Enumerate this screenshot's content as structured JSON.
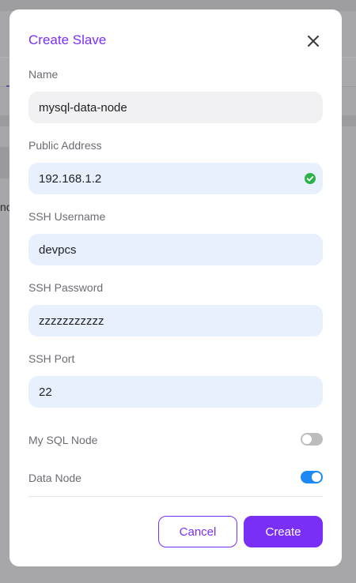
{
  "background": {
    "partial_text": "no"
  },
  "modal": {
    "title": "Create Slave",
    "close_icon": "close-icon"
  },
  "fields": {
    "name": {
      "label": "Name",
      "value": "mysql-data-node"
    },
    "public_address": {
      "label": "Public Address",
      "value": "192.168.1.2",
      "status_icon": "check-circle-icon"
    },
    "ssh_username": {
      "label": "SSH Username",
      "value": "devpcs"
    },
    "ssh_password": {
      "label": "SSH Password",
      "value": "zzzzzzzzzzz"
    },
    "ssh_port": {
      "label": "SSH Port",
      "value": "22"
    }
  },
  "toggles": {
    "mysql_node": {
      "label": "My SQL Node",
      "checked": false
    },
    "data_node": {
      "label": "Data Node",
      "checked": true
    }
  },
  "actions": {
    "cancel_label": "Cancel",
    "create_label": "Create"
  },
  "colors": {
    "accent": "#7a2ff7",
    "toggle_on": "#1e88f5",
    "toggle_off": "#bdbdbd",
    "success": "#2bb34a",
    "input_autofill_bg": "#e8f0fe",
    "input_default_bg": "#f1f1f3"
  }
}
